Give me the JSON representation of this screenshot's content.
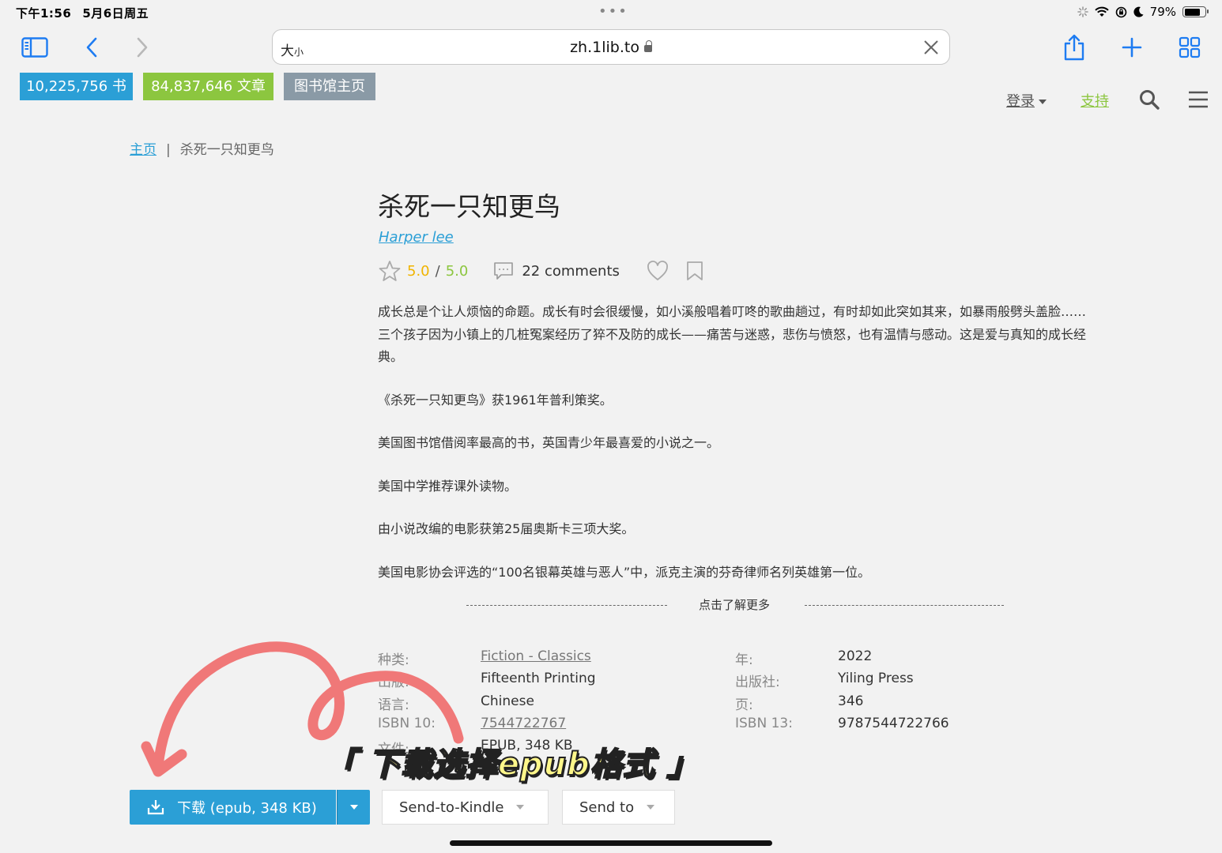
{
  "status_bar": {
    "time": "下午1:56",
    "date": "5月6日周五",
    "battery": "79%"
  },
  "browser": {
    "text_size": "大",
    "text_size_small": "小",
    "url": "zh.1lib.to"
  },
  "site": {
    "books_count": "10,225,756 书",
    "articles_count": "84,837,646 文章",
    "library_home": "图书馆主页",
    "login": "登录",
    "support": "支持"
  },
  "breadcrumb": {
    "home": "主页",
    "separator": "|",
    "current": "杀死一只知更鸟"
  },
  "book": {
    "title": "杀死一只知更鸟",
    "author": "Harper lee",
    "rating": "5.0",
    "rating_max": "5.0",
    "rating_separator": "/",
    "comments": "22 comments",
    "description": [
      "成长总是个让人烦恼的命题。成长有时会很缓慢，如小溪般唱着叮咚的歌曲趟过，有时却如此突如其来，如暴雨般劈头盖脸……三个孩子因为小镇上的几桩冤案经历了猝不及防的成长——痛苦与迷惑，悲伤与愤怒，也有温情与感动。这是爱与真知的成长经典。",
      "《杀死一只知更鸟》获1961年普利策奖。",
      "美国图书馆借阅率最高的书，英国青少年最喜爱的小说之一。",
      "美国中学推荐课外读物。",
      "由小说改编的电影获第25届奥斯卡三项大奖。",
      "美国电影协会评选的“100名银幕英雄与恶人”中，派克主演的芬奇律师名列英雄第一位。"
    ],
    "read_more": "点击了解更多",
    "properties": {
      "category_label": "种类:",
      "category_value": "Fiction - Classics",
      "year_label": "年:",
      "year_value": "2022",
      "edition_label": "出版:",
      "edition_value": "Fifteenth Printing",
      "publisher_label": "出版社:",
      "publisher_value": "Yiling Press",
      "language_label": "语言:",
      "language_value": "Chinese",
      "pages_label": "页:",
      "pages_value": "346",
      "isbn10_label": "ISBN 10:",
      "isbn10_value": "7544722767",
      "isbn13_label": "ISBN 13:",
      "isbn13_value": "9787544722766",
      "file_label": "文件:",
      "file_value": "EPUB, 348 KB"
    }
  },
  "annotation": {
    "caption": "「 下载选择epub格式 」",
    "arrow_color": "#f07878"
  },
  "actions": {
    "download": "下载 (epub, 348 KB)",
    "send_to_kindle": "Send-to-Kindle",
    "send_to": "Send to"
  },
  "colors": {
    "accent_blue": "#2b9fd6",
    "accent_green": "#8cc63f",
    "rating_yellow": "#f0b400",
    "safari_blue": "#1e7cf2"
  }
}
